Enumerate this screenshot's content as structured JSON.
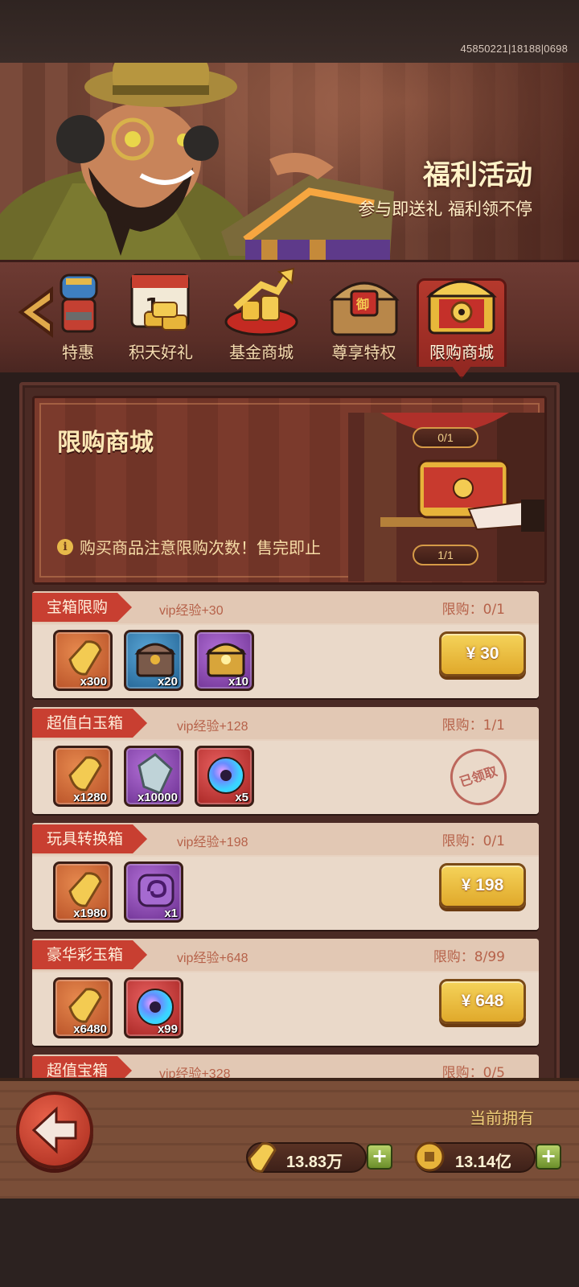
{
  "build_id": "45850221|18188|0698",
  "banner": {
    "title": "福利活动",
    "subtitle": "参与即送礼 福利领不停"
  },
  "tabs": [
    {
      "label": "特惠",
      "icon": "robot-gift-icon"
    },
    {
      "label": "积天好礼",
      "icon": "calendar-gold-icon"
    },
    {
      "label": "基金商城",
      "icon": "fund-growth-icon"
    },
    {
      "label": "尊享特权",
      "icon": "privilege-chest-icon"
    },
    {
      "label": "限购商城",
      "icon": "limited-chest-icon",
      "active": true
    }
  ],
  "promo": {
    "title": "限购商城",
    "notice": "购买商品注意限购次数！售完即止",
    "counter_top": "0/1",
    "counter_bottom": "1/1"
  },
  "offers": [
    {
      "name": "宝箱限购",
      "vip": "vip经验+30",
      "limit": "限购：0/1",
      "items": [
        {
          "icon": "gold-ticket-icon",
          "qty": "x300",
          "bg": "orange"
        },
        {
          "icon": "iron-chest-icon",
          "qty": "x20",
          "bg": "blue"
        },
        {
          "icon": "gold-chest-icon",
          "qty": "x10",
          "bg": "purple"
        }
      ],
      "price": "¥ 30"
    },
    {
      "name": "超值白玉箱",
      "vip": "vip经验+128",
      "limit": "限购：1/1",
      "items": [
        {
          "icon": "gold-ticket-icon",
          "qty": "x1280",
          "bg": "orange"
        },
        {
          "icon": "crystal-icon",
          "qty": "x10000",
          "bg": "purple"
        },
        {
          "icon": "rainbow-orb-icon",
          "qty": "x5",
          "bg": "red"
        }
      ],
      "claimed": "已领取"
    },
    {
      "name": "玩具转换箱",
      "vip": "vip经验+198",
      "limit": "限购：0/1",
      "items": [
        {
          "icon": "gold-ticket-icon",
          "qty": "x1980",
          "bg": "orange"
        },
        {
          "icon": "swirl-token-icon",
          "qty": "x1",
          "bg": "purple"
        }
      ],
      "price": "¥ 198"
    },
    {
      "name": "豪华彩玉箱",
      "vip": "vip经验+648",
      "limit": "限购：8/99",
      "items": [
        {
          "icon": "gold-ticket-icon",
          "qty": "x6480",
          "bg": "orange"
        },
        {
          "icon": "rainbow-orb-icon",
          "qty": "x99",
          "bg": "red"
        }
      ],
      "price": "¥ 648"
    },
    {
      "name": "超值宝箱",
      "vip": "vip经验+328",
      "limit": "限购：0/5"
    }
  ],
  "footer": {
    "owned_label": "当前拥有",
    "ticket_amount": "13.83万",
    "coin_amount": "13.14亿"
  },
  "colors": {
    "ribbon": "#c83f31",
    "price_button": "#f0c444",
    "tab_active": "#b5392d"
  }
}
